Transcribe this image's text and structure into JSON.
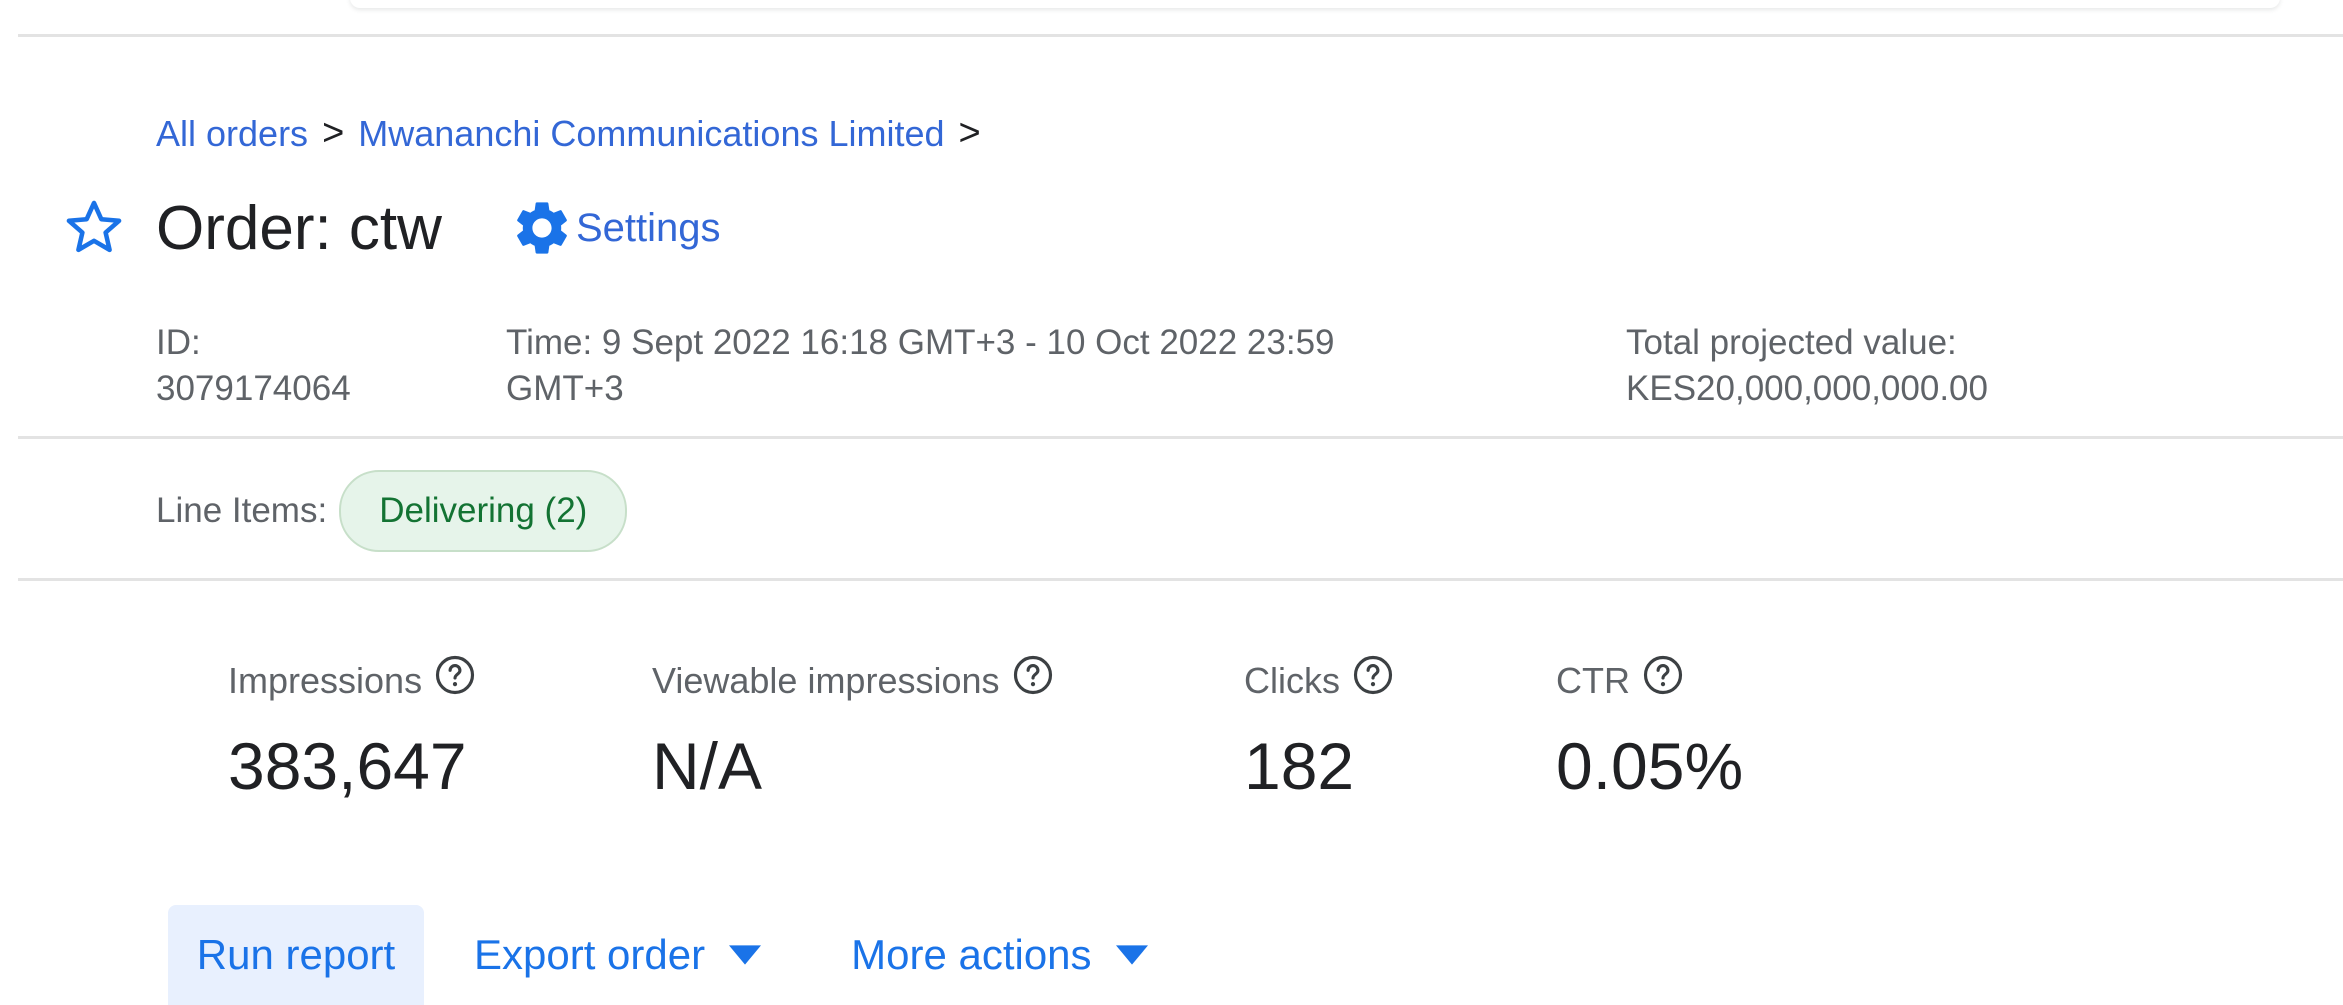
{
  "breadcrumb": {
    "items": [
      "All orders",
      "Mwananchi Communications Limited"
    ],
    "separator": ">"
  },
  "order": {
    "title": "Order: ctw",
    "settings_label": "Settings",
    "star_icon": "star-outline-icon",
    "settings_icon": "gear-icon"
  },
  "meta": {
    "id_label": "ID:",
    "id_value": "3079174064",
    "time_line1": "Time: 9 Sept 2022 16:18 GMT+3 - 10 Oct 2022 23:59",
    "time_line2": "GMT+3",
    "value_label": "Total projected value:",
    "value_amount": "KES20,000,000,000.00"
  },
  "line_items": {
    "label": "Line Items:",
    "chip": "Delivering (2)"
  },
  "stats": [
    {
      "label": "Impressions",
      "value": "383,647"
    },
    {
      "label": "Viewable impressions",
      "value": "N/A"
    },
    {
      "label": "Clicks",
      "value": "182"
    },
    {
      "label": "CTR",
      "value": "0.05%"
    }
  ],
  "actions": {
    "run_report": "Run report",
    "export_order": "Export order",
    "more_actions": "More actions"
  },
  "colors": {
    "link": "#3367d6",
    "accent": "#1a73e8",
    "chip_bg": "#e6f4ea",
    "chip_text": "#137333"
  }
}
